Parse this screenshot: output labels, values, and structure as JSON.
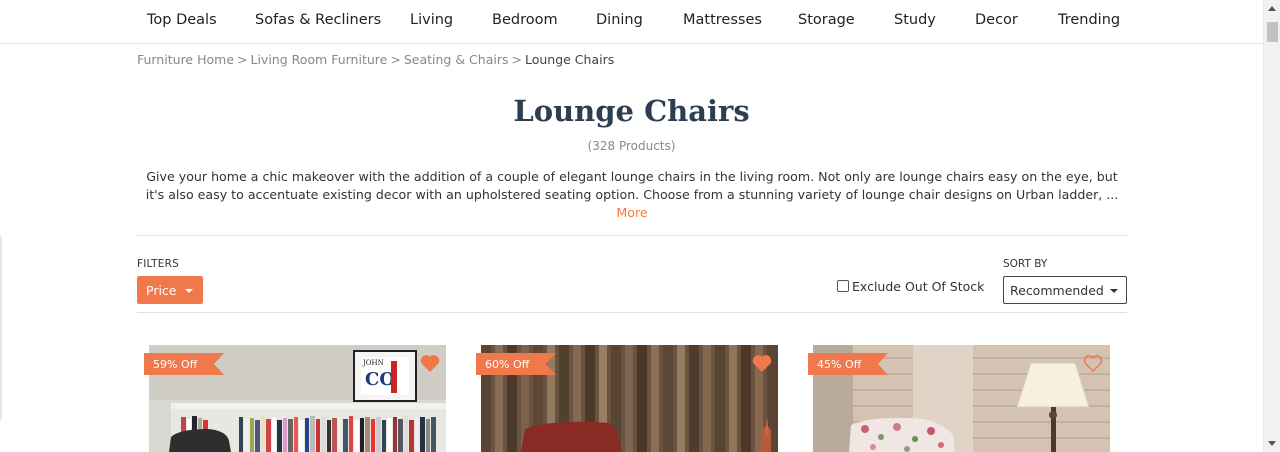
{
  "nav": {
    "items": [
      "Top Deals",
      "Sofas & Recliners",
      "Living",
      "Bedroom",
      "Dining",
      "Mattresses",
      "Storage",
      "Study",
      "Decor",
      "Trending"
    ]
  },
  "breadcrumb": {
    "items": [
      "Furniture Home",
      "Living Room Furniture",
      "Seating & Chairs"
    ],
    "separator": ">",
    "current": "Lounge Chairs"
  },
  "page": {
    "title": "Lounge Chairs",
    "count": "(328 Products)",
    "description": "Give your home a chic makeover with the addition of a couple of elegant lounge chairs in the living room. Not only are lounge chairs easy on the eye, but it's also easy to accentuate existing decor with an upholstered seating option. Choose from a stunning variety of lounge chair designs on Urban ladder, ... ",
    "more_label": "More"
  },
  "filters": {
    "label": "FILTERS",
    "price_label": "Price",
    "exclude_oos_label": "Exclude Out Of Stock",
    "exclude_oos_checked": false
  },
  "sort": {
    "label": "SORT BY",
    "selected": "Recommended"
  },
  "products": [
    {
      "badge": "59% Off",
      "wishlisted": true
    },
    {
      "badge": "60% Off",
      "wishlisted": true
    },
    {
      "badge": "45% Off",
      "wishlisted": false
    }
  ],
  "colors": {
    "accent": "#f0784a",
    "title": "#2c3e50"
  }
}
